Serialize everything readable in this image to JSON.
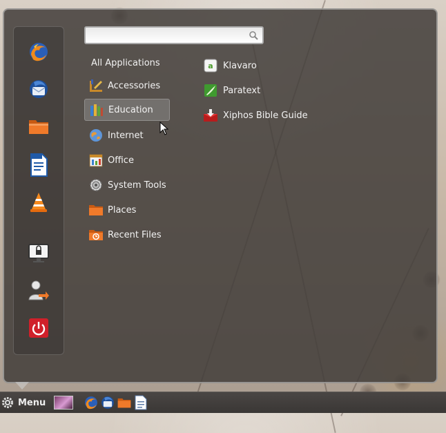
{
  "search": {
    "value": "",
    "placeholder": ""
  },
  "categories": [
    {
      "label": "All Applications",
      "icon": "none"
    },
    {
      "label": "Accessories",
      "icon": "accessories-icon"
    },
    {
      "label": "Education",
      "icon": "education-icon"
    },
    {
      "label": "Internet",
      "icon": "internet-icon"
    },
    {
      "label": "Office",
      "icon": "office-icon"
    },
    {
      "label": "System Tools",
      "icon": "system-tools-icon"
    },
    {
      "label": "Places",
      "icon": "places-folder-icon"
    },
    {
      "label": "Recent Files",
      "icon": "recent-files-icon"
    }
  ],
  "selected_category": "Education",
  "apps": [
    {
      "label": "Klavaro",
      "icon": "klavaro-icon"
    },
    {
      "label": "Paratext",
      "icon": "paratext-icon"
    },
    {
      "label": "Xiphos Bible Guide",
      "icon": "xiphos-icon"
    }
  ],
  "favorites": [
    {
      "icon": "firefox-icon"
    },
    {
      "icon": "thunderbird-icon"
    },
    {
      "icon": "folder-icon"
    },
    {
      "icon": "writer-document-icon"
    },
    {
      "icon": "vlc-icon"
    },
    {
      "icon": "lock-screen-icon"
    },
    {
      "icon": "logout-icon"
    },
    {
      "icon": "power-icon"
    }
  ],
  "panel": {
    "menu_label": "Menu",
    "launchers": [
      {
        "icon": "firefox-icon"
      },
      {
        "icon": "thunderbird-icon"
      },
      {
        "icon": "folder-icon"
      },
      {
        "icon": "text-document-icon"
      }
    ]
  },
  "colors": {
    "popup_background": "#423e3a",
    "selected_highlight": "#969696",
    "power_red": "#d0202a",
    "folder_orange": "#f07a2a"
  }
}
